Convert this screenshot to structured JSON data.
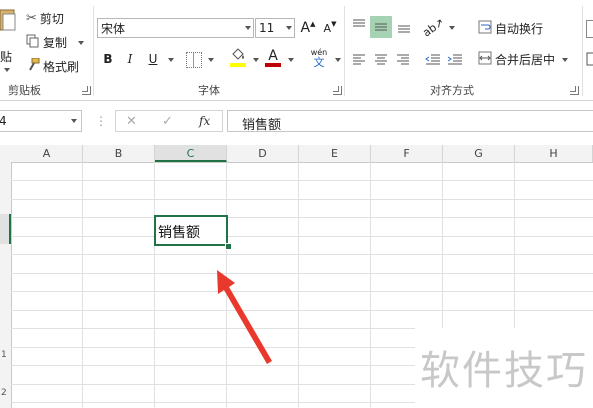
{
  "clipboard": {
    "paste_label": "贴",
    "cut_label": "剪切",
    "copy_label": "复制",
    "format_painter_label": "格式刷",
    "group_label": "剪贴板"
  },
  "font": {
    "font_name": "宋体",
    "font_size": "11",
    "bold": "B",
    "italic": "I",
    "underline": "U",
    "grow_font": "A",
    "shrink_font": "A",
    "wen_top": "wén",
    "wen_bottom": "文",
    "font_color_letter": "A",
    "group_label": "字体",
    "accent_font_color": "#c00000",
    "accent_fill_color": "#ffff00"
  },
  "alignment": {
    "wrap_text_label": "自动换行",
    "merge_center_label": "合并后居中",
    "group_label": "对齐方式"
  },
  "formula_bar": {
    "name_box_value": "4",
    "cancel_icon": "✕",
    "enter_icon": "✓",
    "fx_label": "fx",
    "content": "销售额"
  },
  "grid": {
    "columns": [
      "A",
      "B",
      "C",
      "D",
      "E",
      "F",
      "G",
      "H"
    ],
    "selected_column": "C",
    "row_labels": [
      "1",
      "2"
    ],
    "active_cell_value": "销售额",
    "accent_color": "#217346"
  },
  "annotation": {
    "arrow_color": "#e8392c"
  },
  "watermark": {
    "text": "软件技巧"
  }
}
